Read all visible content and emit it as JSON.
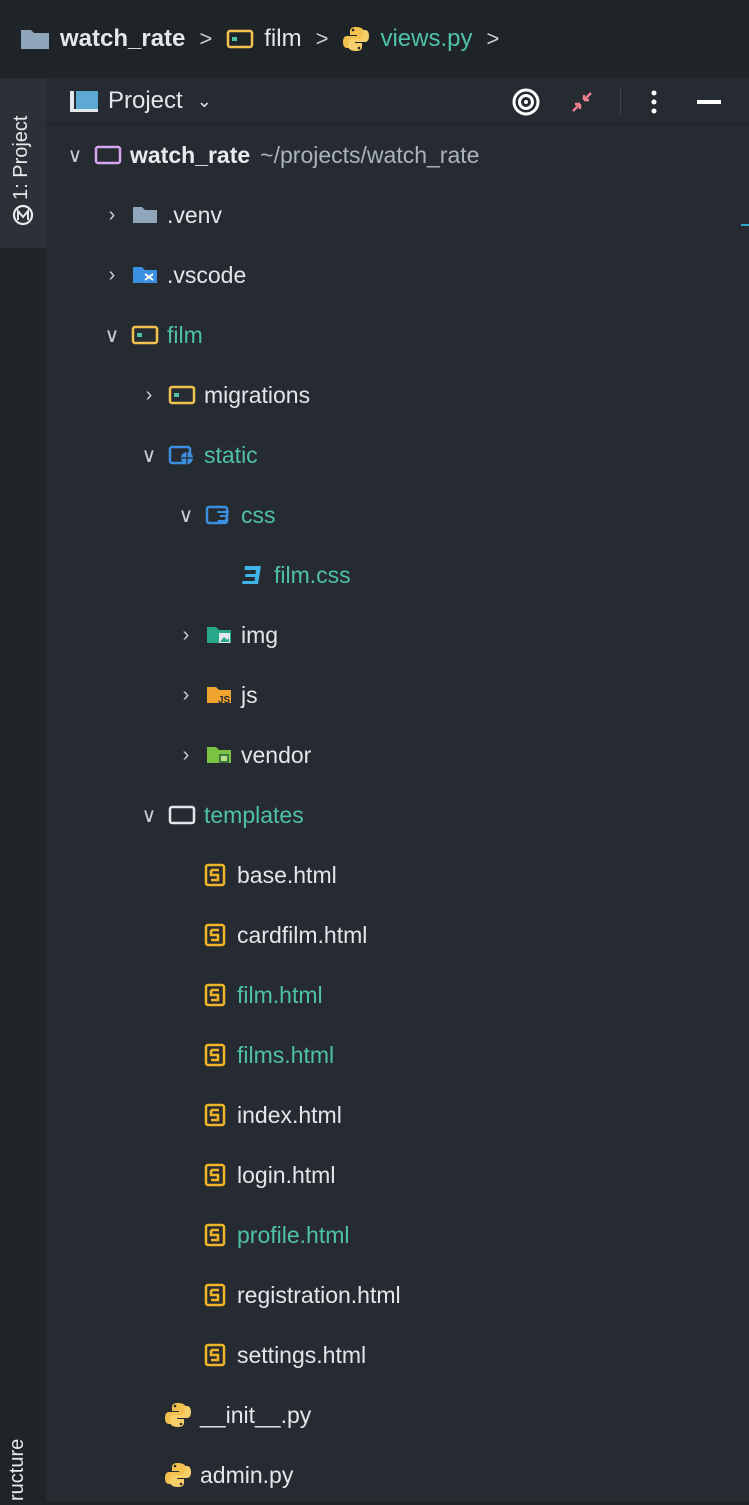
{
  "breadcrumb": {
    "items": [
      {
        "label": "watch_rate",
        "icon": "folder-icon"
      },
      {
        "label": "film",
        "icon": "package-folder-icon"
      },
      {
        "label": "views.py",
        "icon": "python-file-icon"
      }
    ],
    "separator": ">"
  },
  "tool_strip": {
    "project_tab": "1: Project",
    "structure_tab": "ructure"
  },
  "panel": {
    "title": "Project",
    "dropdown_icon": "chevron-down-icon",
    "tools": [
      "locate-icon",
      "collapse-icon",
      "more-icon",
      "minimize-icon"
    ]
  },
  "tree": {
    "root": {
      "label": "watch_rate",
      "path": "~/projects/watch_rate"
    },
    "items": [
      {
        "label": ".venv",
        "icon": "folder-icon",
        "expanded": false,
        "depth": 1
      },
      {
        "label": ".vscode",
        "icon": "vscode-folder-icon",
        "expanded": false,
        "depth": 1
      },
      {
        "label": "film",
        "icon": "package-folder-icon",
        "expanded": true,
        "depth": 1
      },
      {
        "label": "migrations",
        "icon": "package-folder-icon",
        "expanded": false,
        "depth": 2
      },
      {
        "label": "static",
        "icon": "web-folder-icon",
        "expanded": true,
        "depth": 2
      },
      {
        "label": "css",
        "icon": "css-folder-icon",
        "expanded": true,
        "depth": 3
      },
      {
        "label": "film.css",
        "icon": "css-file-icon",
        "depth": 4
      },
      {
        "label": "img",
        "icon": "image-folder-icon",
        "expanded": false,
        "depth": 3
      },
      {
        "label": "js",
        "icon": "js-folder-icon",
        "expanded": false,
        "depth": 3
      },
      {
        "label": "vendor",
        "icon": "vendor-folder-icon",
        "expanded": false,
        "depth": 3
      },
      {
        "label": "templates",
        "icon": "folder-outline-icon",
        "expanded": true,
        "depth": 2
      },
      {
        "label": "base.html",
        "icon": "html-file-icon",
        "depth": 3
      },
      {
        "label": "cardfilm.html",
        "icon": "html-file-icon",
        "depth": 3
      },
      {
        "label": "film.html",
        "icon": "html-file-icon",
        "depth": 3
      },
      {
        "label": "films.html",
        "icon": "html-file-icon",
        "depth": 3
      },
      {
        "label": "index.html",
        "icon": "html-file-icon",
        "depth": 3
      },
      {
        "label": "login.html",
        "icon": "html-file-icon",
        "depth": 3
      },
      {
        "label": "profile.html",
        "icon": "html-file-icon",
        "depth": 3
      },
      {
        "label": "registration.html",
        "icon": "html-file-icon",
        "depth": 3
      },
      {
        "label": "settings.html",
        "icon": "html-file-icon",
        "depth": 3
      },
      {
        "label": "__init__.py",
        "icon": "python-file-icon",
        "depth": 2
      },
      {
        "label": "admin.py",
        "icon": "python-file-icon",
        "depth": 2
      }
    ]
  },
  "colors": {
    "background": "#262b31",
    "accent_green": "#4fc1a6",
    "text": "#e3e7ec",
    "html_icon": "#f0b429",
    "python_icon": "#f2c14e"
  }
}
